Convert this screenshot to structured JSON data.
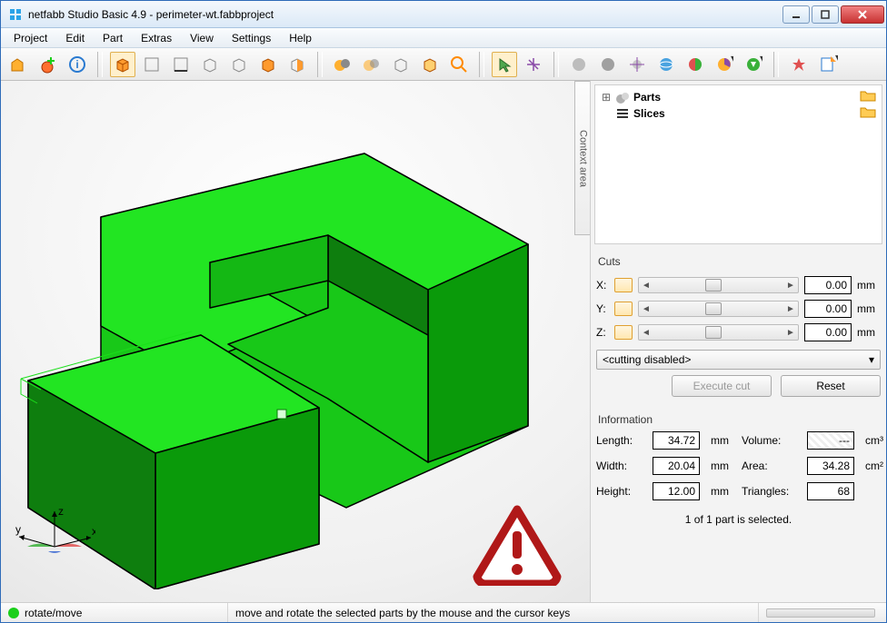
{
  "window": {
    "title": "netfabb Studio Basic 4.9 - perimeter-wt.fabbproject"
  },
  "menu": [
    "Project",
    "Edit",
    "Part",
    "Extras",
    "View",
    "Settings",
    "Help"
  ],
  "context_label": "Context area",
  "tree": {
    "parts_label": "Parts",
    "slices_label": "Slices"
  },
  "cuts": {
    "header": "Cuts",
    "x_label": "X:",
    "y_label": "Y:",
    "z_label": "Z:",
    "x_value": "0.00",
    "y_value": "0.00",
    "z_value": "0.00",
    "unit": "mm",
    "mode": "<cutting disabled>",
    "execute": "Execute cut",
    "reset": "Reset"
  },
  "info": {
    "header": "Information",
    "length_label": "Length:",
    "width_label": "Width:",
    "height_label": "Height:",
    "volume_label": "Volume:",
    "area_label": "Area:",
    "triangles_label": "Triangles:",
    "length": "34.72",
    "width": "20.04",
    "height": "12.00",
    "volume": "---",
    "area": "34.28",
    "triangles": "68",
    "mm": "mm",
    "cm3": "cm³",
    "cm2": "cm²",
    "selection": "1 of 1 part is selected."
  },
  "status": {
    "mode": "rotate/move",
    "hint": "move and rotate the selected parts by the mouse and the cursor keys"
  }
}
